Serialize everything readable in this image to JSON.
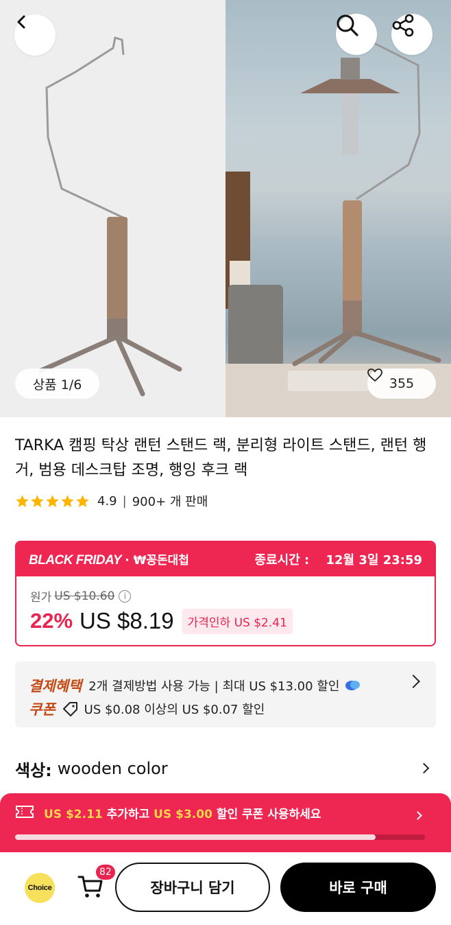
{
  "gallery": {
    "counter": "상품 1/6",
    "likes": "355"
  },
  "product": {
    "title": "TARKA 캠핑 탁상 랜턴 스탠드 랙, 분리형 라이트 스탠드, 랜턴 행거, 범용 데스크탑 조명, 행잉 후크 랙",
    "rating": "4.9",
    "sold": "900+ 개 판매",
    "star_count": 5
  },
  "promo": {
    "brand": "BLACK FRIDAY",
    "sub": "· ₩꽁돈대첩",
    "ends_label": "종료시간 :",
    "ends_value": "12월 3일 23:59",
    "original_label": "원가",
    "original_price": "US $10.60",
    "discount": "22%",
    "price": "US $8.19",
    "price_drop": "가격인하 US $2.41"
  },
  "benefits": {
    "payment_tag": "결제혜택",
    "payment_text": "2개 결제방법 사용 가능 | 최대 US $13.00 할인",
    "coupon_tag": "쿠폰",
    "coupon_text": "US $0.08 이상의 US $0.07 할인"
  },
  "color": {
    "label": "색상:",
    "value": "wooden color"
  },
  "coupon_banner": {
    "amount1": "US $2.11",
    "text1": " 추가하고 ",
    "amount2": "US $3.00",
    "text2": " 할인 쿠폰 사용하세요",
    "progress": 0.88
  },
  "bottom_bar": {
    "choice_label": "Choice",
    "cart_count": "82",
    "add_to_cart": "장바구니 담기",
    "buy_now": "바로 구매"
  },
  "colors": {
    "accent": "#ee2652",
    "price_red": "#e8244f",
    "benefit_orange": "#c44a14",
    "star": "#ffb400"
  }
}
